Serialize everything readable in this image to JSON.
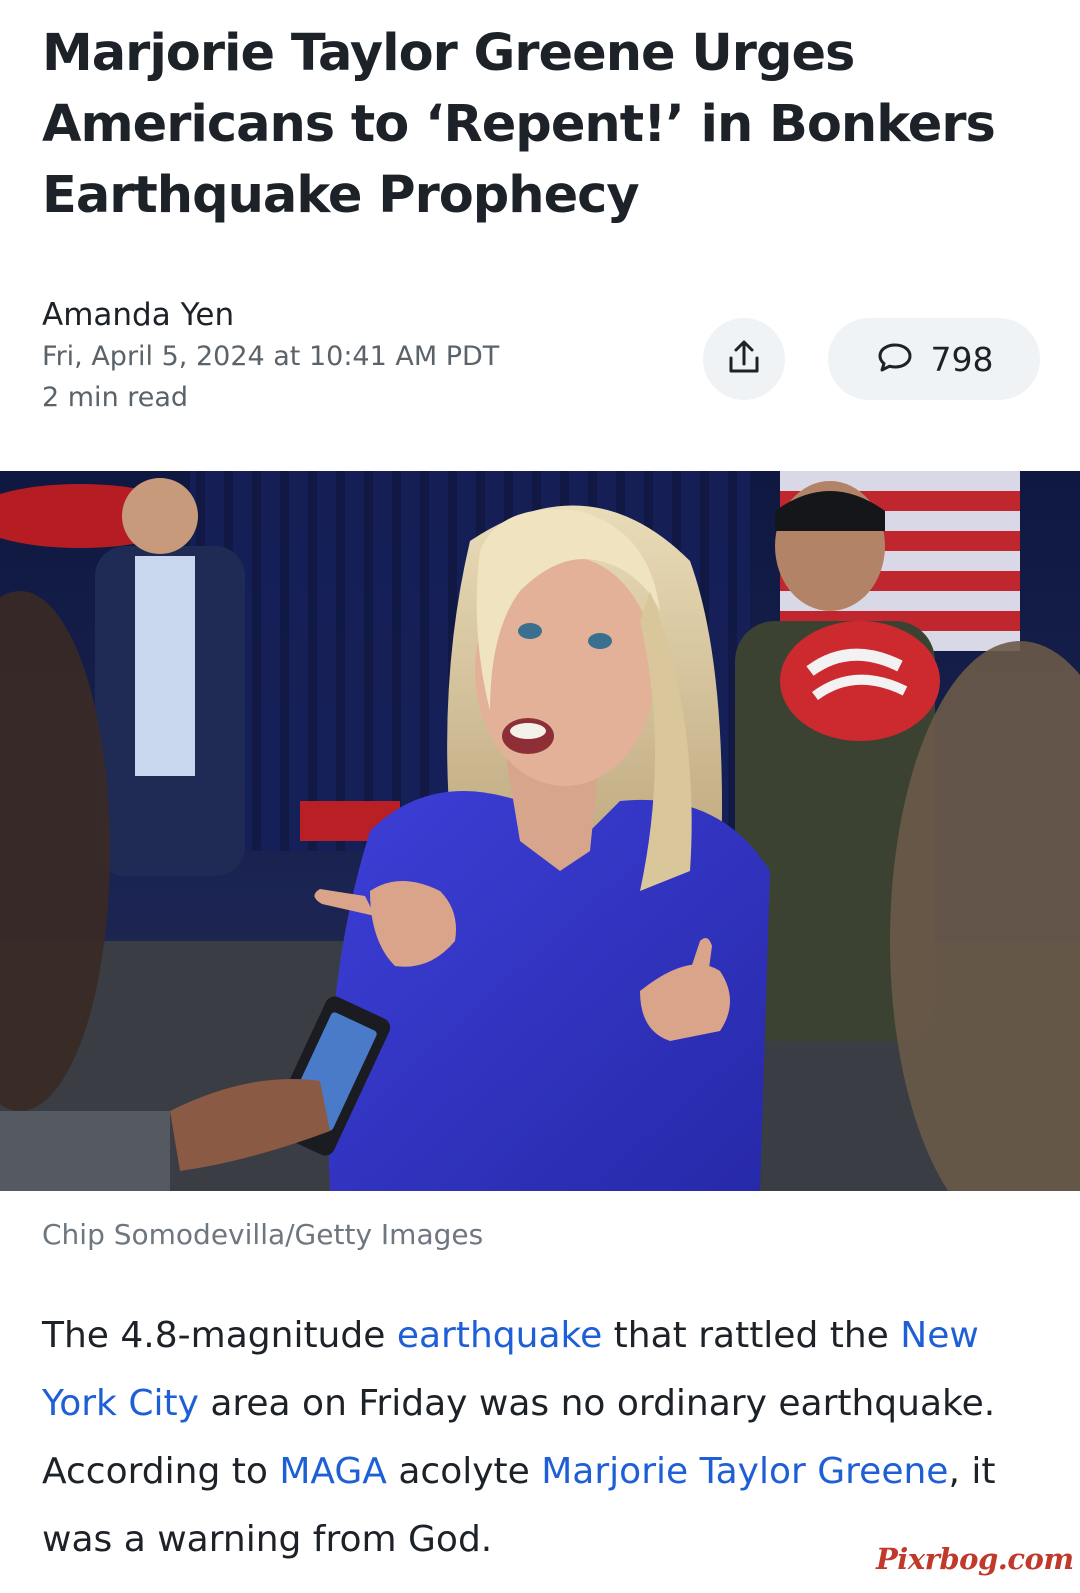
{
  "article": {
    "headline": "Marjorie Taylor Greene Urges Americans to ‘Repent!’ in Bonkers Earthquake Prophecy",
    "author": "Amanda Yen",
    "date": "Fri, April 5, 2024 at 10:41 AM PDT",
    "read_time": "2 min read",
    "comment_count": "798",
    "image_caption": "Chip Somodevilla/Getty Images",
    "body": {
      "t1": "The 4.8-magnitude ",
      "link_earthquake": "earthquake",
      "t2": " that rattled the ",
      "link_nyc": "New York City",
      "t3": " area on Friday was no ordinary earthquake. According to ",
      "link_maga": "MAGA",
      "t4": " acolyte ",
      "link_mtg": "Marjorie Taylor Greene",
      "t5": ", it was a warning from God."
    }
  },
  "watermark": "Pixrbog.com",
  "icons": {
    "share": "share-icon",
    "comment": "comment-bubble-icon"
  },
  "colors": {
    "link": "#1f5fd6",
    "text": "#1d2228",
    "muted": "#5b636a",
    "button_bg": "#f0f3f5",
    "watermark": "#c0392b"
  }
}
